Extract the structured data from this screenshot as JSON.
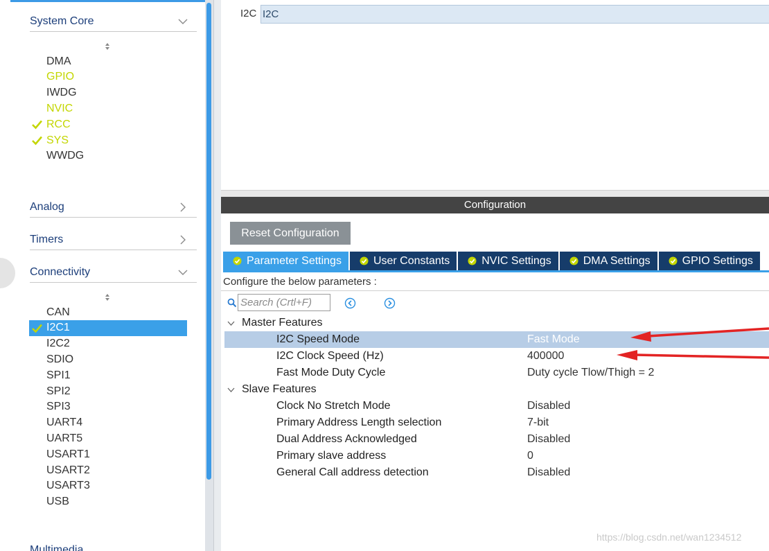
{
  "sidebar": {
    "categories": {
      "system_core": "System Core",
      "analog": "Analog",
      "timers": "Timers",
      "connectivity": "Connectivity"
    },
    "system_core_items": [
      {
        "label": "DMA",
        "status": "plain"
      },
      {
        "label": "GPIO",
        "status": "green"
      },
      {
        "label": "IWDG",
        "status": "plain"
      },
      {
        "label": "NVIC",
        "status": "green"
      },
      {
        "label": "RCC",
        "status": "checked"
      },
      {
        "label": "SYS",
        "status": "checked"
      },
      {
        "label": "WWDG",
        "status": "plain"
      }
    ],
    "connectivity_items": [
      {
        "label": "CAN",
        "status": "plain"
      },
      {
        "label": "I2C1",
        "status": "checked-selected"
      },
      {
        "label": "I2C2",
        "status": "plain"
      },
      {
        "label": "SDIO",
        "status": "plain"
      },
      {
        "label": "SPI1",
        "status": "plain"
      },
      {
        "label": "SPI2",
        "status": "plain"
      },
      {
        "label": "SPI3",
        "status": "plain"
      },
      {
        "label": "UART4",
        "status": "plain"
      },
      {
        "label": "UART5",
        "status": "plain"
      },
      {
        "label": "USART1",
        "status": "plain"
      },
      {
        "label": "USART2",
        "status": "plain"
      },
      {
        "label": "USART3",
        "status": "plain"
      },
      {
        "label": "USB",
        "status": "plain"
      }
    ],
    "cut_off_category": "Multimedia"
  },
  "mode": {
    "label": "I2C",
    "value": "I2C"
  },
  "configuration": {
    "title": "Configuration",
    "reset_button": "Reset Configuration",
    "tabs": [
      {
        "label": "Parameter Settings",
        "active": true
      },
      {
        "label": "User Constants",
        "active": false
      },
      {
        "label": "NVIC Settings",
        "active": false
      },
      {
        "label": "DMA Settings",
        "active": false
      },
      {
        "label": "GPIO Settings",
        "active": false
      }
    ],
    "hint": "Configure the below parameters :",
    "search_placeholder": "Search (Crtl+F)",
    "groups": {
      "master": "Master Features",
      "slave": "Slave Features"
    },
    "master_params": [
      {
        "name": "I2C Speed Mode",
        "value": "Fast Mode"
      },
      {
        "name": "I2C Clock Speed (Hz)",
        "value": "400000"
      },
      {
        "name": "Fast Mode Duty Cycle",
        "value": "Duty cycle Tlow/Thigh = 2"
      }
    ],
    "slave_params": [
      {
        "name": "Clock No Stretch Mode",
        "value": "Disabled"
      },
      {
        "name": "Primary Address Length selection",
        "value": "7-bit"
      },
      {
        "name": "Dual Address Acknowledged",
        "value": "Disabled"
      },
      {
        "name": "Primary slave address",
        "value": "0"
      },
      {
        "name": "General Call address detection",
        "value": "Disabled"
      }
    ]
  },
  "watermark": "https://blog.csdn.net/wan1234512",
  "colors": {
    "accent_blue": "#3aa0e8",
    "tab_navy": "#163c6a",
    "enabled_green": "#c3d600",
    "annotation_red": "#e32424",
    "selected_row": "#b7cde6"
  },
  "icons": {
    "check": "check-icon",
    "chevron_down": "chevron-down-icon",
    "chevron_right": "chevron-right-icon",
    "search": "search-icon",
    "nav_prev": "circle-arrow-left-icon",
    "nav_next": "circle-arrow-right-icon",
    "sort": "sort-icon",
    "tab_check": "check-circle-icon"
  }
}
